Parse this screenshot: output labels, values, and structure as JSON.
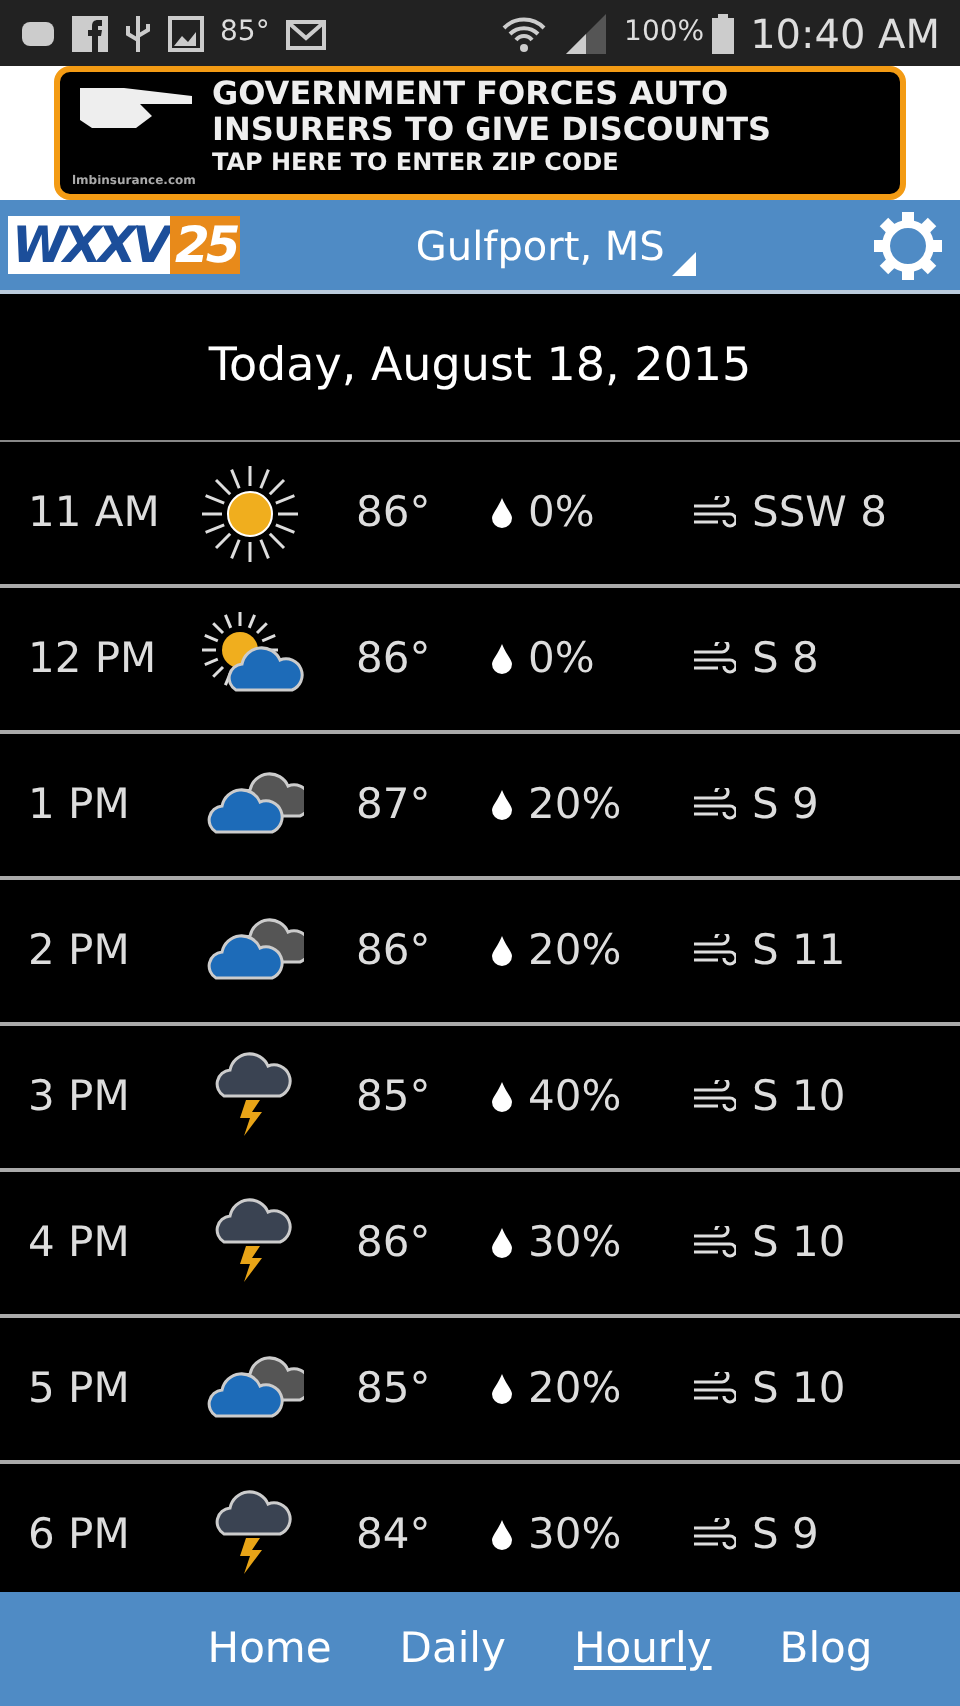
{
  "status_bar": {
    "temperature": "85°",
    "battery": "100%",
    "time": "10:40 AM"
  },
  "ad": {
    "headline_1": "GOVERNMENT FORCES AUTO",
    "headline_2": "INSURERS TO GIVE DISCOUNTS",
    "call_to_action": "TAP HERE TO ENTER ZIP CODE",
    "site": "lmbinsurance.com"
  },
  "header": {
    "logo_letters": "WXXV",
    "logo_number": "25",
    "location": "Gulfport, MS"
  },
  "date": "Today, August 18, 2015",
  "hours": [
    {
      "time": "11 AM",
      "kind": "sunny",
      "temp": "86°",
      "precip": "0%",
      "wind": "SSW 8"
    },
    {
      "time": "12 PM",
      "kind": "partly-sunny",
      "temp": "86°",
      "precip": "0%",
      "wind": "S 8"
    },
    {
      "time": "1 PM",
      "kind": "cloudy",
      "temp": "87°",
      "precip": "20%",
      "wind": "S 9"
    },
    {
      "time": "2 PM",
      "kind": "cloudy",
      "temp": "86°",
      "precip": "20%",
      "wind": "S 11"
    },
    {
      "time": "3 PM",
      "kind": "storm",
      "temp": "85°",
      "precip": "40%",
      "wind": "S 10"
    },
    {
      "time": "4 PM",
      "kind": "storm",
      "temp": "86°",
      "precip": "30%",
      "wind": "S 10"
    },
    {
      "time": "5 PM",
      "kind": "cloudy",
      "temp": "85°",
      "precip": "20%",
      "wind": "S 10"
    },
    {
      "time": "6 PM",
      "kind": "storm",
      "temp": "84°",
      "precip": "30%",
      "wind": "S 9"
    }
  ],
  "nav": [
    {
      "label": "Home",
      "selected": false
    },
    {
      "label": "Daily",
      "selected": false
    },
    {
      "label": "Hourly",
      "selected": true
    },
    {
      "label": "Blog",
      "selected": false
    }
  ]
}
